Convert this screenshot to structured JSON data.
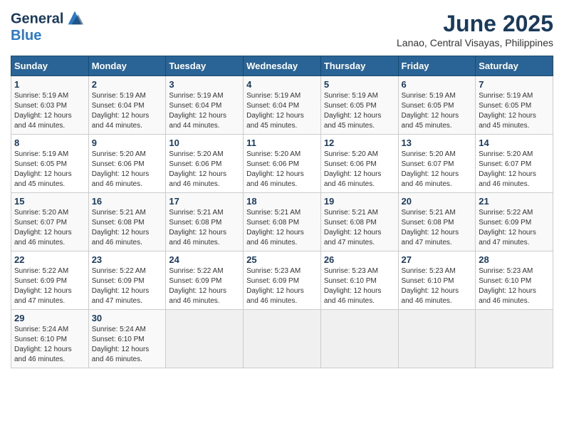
{
  "logo": {
    "line1": "General",
    "line2": "Blue"
  },
  "title": "June 2025",
  "location": "Lanao, Central Visayas, Philippines",
  "weekdays": [
    "Sunday",
    "Monday",
    "Tuesday",
    "Wednesday",
    "Thursday",
    "Friday",
    "Saturday"
  ],
  "weeks": [
    [
      {
        "day": "1",
        "sunrise": "5:19 AM",
        "sunset": "6:03 PM",
        "daylight": "12 hours and 44 minutes."
      },
      {
        "day": "2",
        "sunrise": "5:19 AM",
        "sunset": "6:04 PM",
        "daylight": "12 hours and 44 minutes."
      },
      {
        "day": "3",
        "sunrise": "5:19 AM",
        "sunset": "6:04 PM",
        "daylight": "12 hours and 44 minutes."
      },
      {
        "day": "4",
        "sunrise": "5:19 AM",
        "sunset": "6:04 PM",
        "daylight": "12 hours and 45 minutes."
      },
      {
        "day": "5",
        "sunrise": "5:19 AM",
        "sunset": "6:05 PM",
        "daylight": "12 hours and 45 minutes."
      },
      {
        "day": "6",
        "sunrise": "5:19 AM",
        "sunset": "6:05 PM",
        "daylight": "12 hours and 45 minutes."
      },
      {
        "day": "7",
        "sunrise": "5:19 AM",
        "sunset": "6:05 PM",
        "daylight": "12 hours and 45 minutes."
      }
    ],
    [
      {
        "day": "8",
        "sunrise": "5:19 AM",
        "sunset": "6:05 PM",
        "daylight": "12 hours and 45 minutes."
      },
      {
        "day": "9",
        "sunrise": "5:20 AM",
        "sunset": "6:06 PM",
        "daylight": "12 hours and 46 minutes."
      },
      {
        "day": "10",
        "sunrise": "5:20 AM",
        "sunset": "6:06 PM",
        "daylight": "12 hours and 46 minutes."
      },
      {
        "day": "11",
        "sunrise": "5:20 AM",
        "sunset": "6:06 PM",
        "daylight": "12 hours and 46 minutes."
      },
      {
        "day": "12",
        "sunrise": "5:20 AM",
        "sunset": "6:06 PM",
        "daylight": "12 hours and 46 minutes."
      },
      {
        "day": "13",
        "sunrise": "5:20 AM",
        "sunset": "6:07 PM",
        "daylight": "12 hours and 46 minutes."
      },
      {
        "day": "14",
        "sunrise": "5:20 AM",
        "sunset": "6:07 PM",
        "daylight": "12 hours and 46 minutes."
      }
    ],
    [
      {
        "day": "15",
        "sunrise": "5:20 AM",
        "sunset": "6:07 PM",
        "daylight": "12 hours and 46 minutes."
      },
      {
        "day": "16",
        "sunrise": "5:21 AM",
        "sunset": "6:08 PM",
        "daylight": "12 hours and 46 minutes."
      },
      {
        "day": "17",
        "sunrise": "5:21 AM",
        "sunset": "6:08 PM",
        "daylight": "12 hours and 46 minutes."
      },
      {
        "day": "18",
        "sunrise": "5:21 AM",
        "sunset": "6:08 PM",
        "daylight": "12 hours and 46 minutes."
      },
      {
        "day": "19",
        "sunrise": "5:21 AM",
        "sunset": "6:08 PM",
        "daylight": "12 hours and 47 minutes."
      },
      {
        "day": "20",
        "sunrise": "5:21 AM",
        "sunset": "6:08 PM",
        "daylight": "12 hours and 47 minutes."
      },
      {
        "day": "21",
        "sunrise": "5:22 AM",
        "sunset": "6:09 PM",
        "daylight": "12 hours and 47 minutes."
      }
    ],
    [
      {
        "day": "22",
        "sunrise": "5:22 AM",
        "sunset": "6:09 PM",
        "daylight": "12 hours and 47 minutes."
      },
      {
        "day": "23",
        "sunrise": "5:22 AM",
        "sunset": "6:09 PM",
        "daylight": "12 hours and 47 minutes."
      },
      {
        "day": "24",
        "sunrise": "5:22 AM",
        "sunset": "6:09 PM",
        "daylight": "12 hours and 46 minutes."
      },
      {
        "day": "25",
        "sunrise": "5:23 AM",
        "sunset": "6:09 PM",
        "daylight": "12 hours and 46 minutes."
      },
      {
        "day": "26",
        "sunrise": "5:23 AM",
        "sunset": "6:10 PM",
        "daylight": "12 hours and 46 minutes."
      },
      {
        "day": "27",
        "sunrise": "5:23 AM",
        "sunset": "6:10 PM",
        "daylight": "12 hours and 46 minutes."
      },
      {
        "day": "28",
        "sunrise": "5:23 AM",
        "sunset": "6:10 PM",
        "daylight": "12 hours and 46 minutes."
      }
    ],
    [
      {
        "day": "29",
        "sunrise": "5:24 AM",
        "sunset": "6:10 PM",
        "daylight": "12 hours and 46 minutes."
      },
      {
        "day": "30",
        "sunrise": "5:24 AM",
        "sunset": "6:10 PM",
        "daylight": "12 hours and 46 minutes."
      },
      null,
      null,
      null,
      null,
      null
    ]
  ]
}
